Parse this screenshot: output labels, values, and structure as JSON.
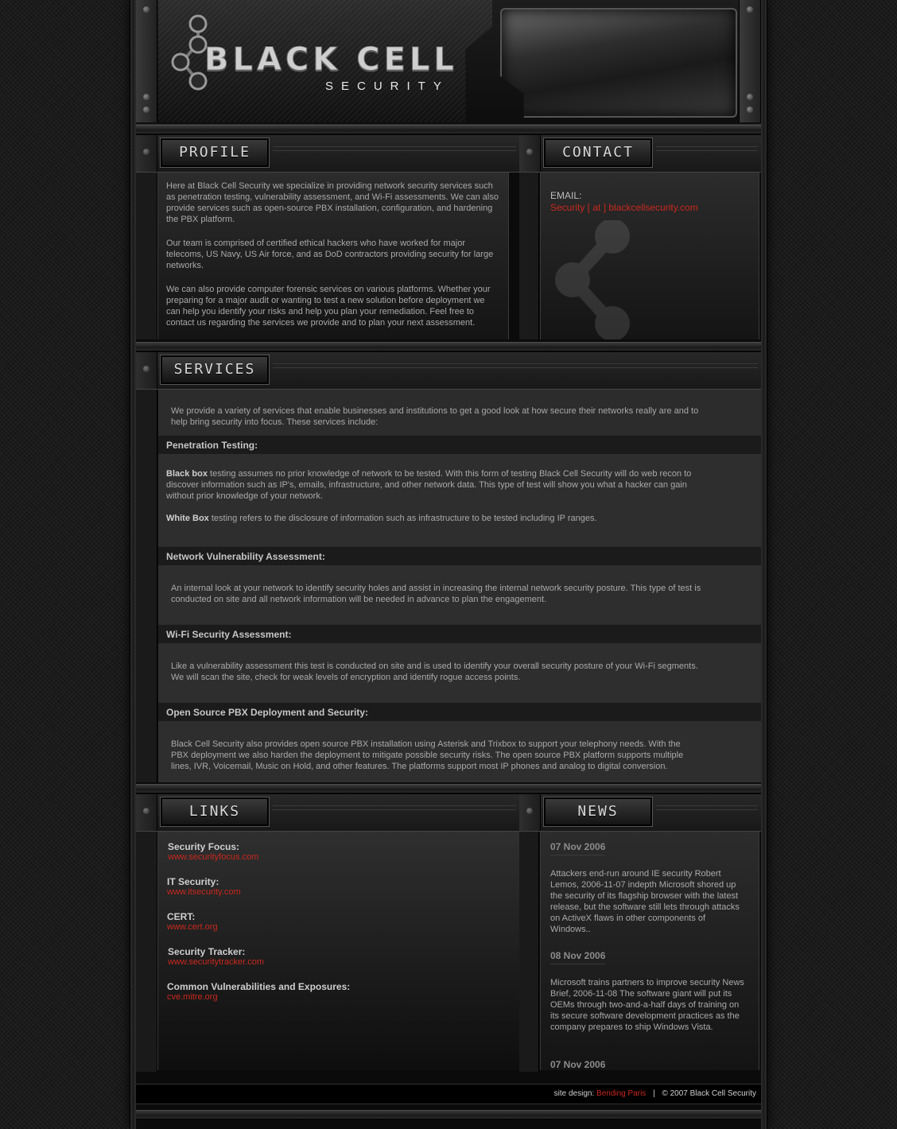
{
  "header": {
    "logo_title": "BLACK CELL",
    "logo_subtitle": "SECURITY"
  },
  "profile": {
    "heading": "PROFILE",
    "paragraphs": [
      "Here at Black Cell Security we specialize in providing network security services such as penetration testing, vulnerability assessment, and Wi-Fi assessments. We can also provide services such as open-source PBX installation, configuration, and hardening the PBX platform.",
      "Our team is comprised of certified ethical hackers who have worked for major telecoms, US Navy, US Air force, and as DoD contractors providing security for large networks.",
      "We can also provide computer forensic services on various platforms. Whether your preparing for a major audit or wanting to test a new solution before deployment we can help you identify your risks and help you plan your remediation. Feel free to contact us regarding the services we provide and to plan your next assessment."
    ]
  },
  "contact": {
    "heading": "CONTACT",
    "email_label": "EMAIL:",
    "email_value": "Security [ at ] blackcellsecurity.com"
  },
  "services": {
    "heading": "SERVICES",
    "intro": "We provide a variety of services that enable businesses and institutions to get a good look at how secure their networks really are and to help bring security into focus. These services include:",
    "pentest": {
      "title": "Penetration Testing:",
      "blackbox_bold": "Black box",
      "blackbox_text": " testing assumes no prior knowledge of network to be tested. With this form of testing Black Cell Security will do web recon to discover information such as IP's, emails, infrastructure, and other network data. This type of test will show you what a hacker can gain without prior knowledge of your network.",
      "whitebox_bold": "White Box",
      "whitebox_text": " testing refers to the disclosure of information such as infrastructure to be tested including IP ranges."
    },
    "vuln": {
      "title": "Network Vulnerability Assessment:",
      "text": "An internal look at your network to identify security holes and assist in increasing the internal network security posture. This type of test is conducted on site and all network information will be needed in advance to plan the engagement."
    },
    "wifi": {
      "title": "Wi-Fi Security Assessment:",
      "text": "Like a vulnerability assessment this test is conducted on site and is used to identify your overall security posture of your Wi-Fi segments. We will scan the site, check for weak levels of encryption and identify rogue access points."
    },
    "pbx": {
      "title": "Open Source PBX Deployment and Security:",
      "text": "Black Cell Security also provides open source PBX installation using Asterisk and Trixbox to support your telephony needs. With the PBX deployment we also harden the deployment to mitigate possible security risks. The open source PBX platform supports multiple lines, IVR, Voicemail, Music on Hold, and other features. The platforms support most IP phones and analog to digital conversion."
    }
  },
  "links": {
    "heading": "LINKS",
    "items": [
      {
        "title": "Security Focus:",
        "url": "www.securityfocus.com"
      },
      {
        "title": "IT Security:",
        "url": "www.itsecurity.com"
      },
      {
        "title": "CERT:",
        "url": "www.cert.org"
      },
      {
        "title": "Security Tracker:",
        "url": "www.securitytracker.com"
      },
      {
        "title": "Common Vulnerabilities and Exposures:",
        "url": "cve.mitre.org"
      }
    ]
  },
  "news": {
    "heading": "NEWS",
    "items": [
      {
        "date": "07 Nov 2006",
        "text": "Attackers end-run around IE security Robert Lemos, 2006-11-07 indepth Microsoft shored up the security of its flagship browser with the latest release, but the software still lets through attacks on ActiveX flaws in other components of Windows.."
      },
      {
        "date": "08 Nov 2006",
        "text": "Microsoft trains partners to improve security News Brief, 2006-11-08 The software giant will put its OEMs through two-and-a-half days of training on its secure software development practices as the company prepares to ship Windows Vista."
      },
      {
        "date": "07 Nov 2006",
        "text": ""
      }
    ]
  },
  "footer": {
    "design_label": "site design:",
    "designer": "Bending Paris",
    "separator": "|",
    "copyright": "© 2007 Black Cell Security"
  },
  "colors": {
    "accent": "#c8281e",
    "background": "#1c1c1c",
    "panel": "#2e2e2e"
  }
}
